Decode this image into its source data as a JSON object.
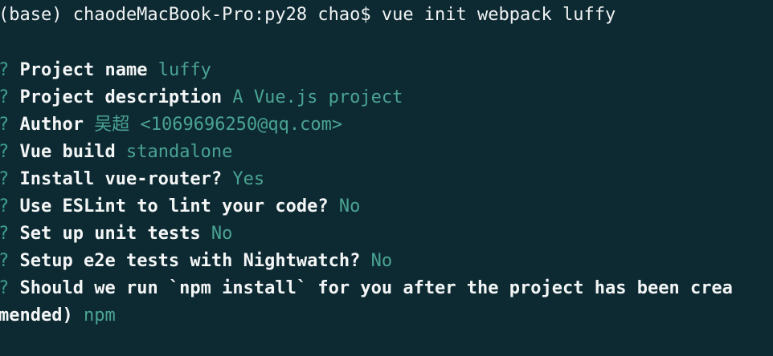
{
  "colors": {
    "background": "#0d2a33",
    "text": "#f1f3f3",
    "prompt_mark": "#3f9f8f",
    "answer": "#4aa392"
  },
  "command_line": "(base) chaodeMacBook-Pro:py28 chao$ vue init webpack luffy",
  "prompts": [
    {
      "mark": "?",
      "label": "Project name",
      "answer": "luffy"
    },
    {
      "mark": "?",
      "label": "Project description",
      "answer": "A Vue.js project"
    },
    {
      "mark": "?",
      "label": "Author",
      "answer": "吴超 <1069696250@qq.com>"
    },
    {
      "mark": "?",
      "label": "Vue build",
      "answer": "standalone"
    },
    {
      "mark": "?",
      "label": "Install vue-router?",
      "answer": "Yes"
    },
    {
      "mark": "?",
      "label": "Use ESLint to lint your code?",
      "answer": "No"
    },
    {
      "mark": "?",
      "label": "Set up unit tests",
      "answer": "No"
    },
    {
      "mark": "?",
      "label": "Setup e2e tests with Nightwatch?",
      "answer": "No"
    },
    {
      "mark": "?",
      "label": "Should we run `npm install` for you after the project has been crea",
      "answer": ""
    }
  ],
  "continuation": {
    "text": "mended)",
    "answer": "npm"
  }
}
